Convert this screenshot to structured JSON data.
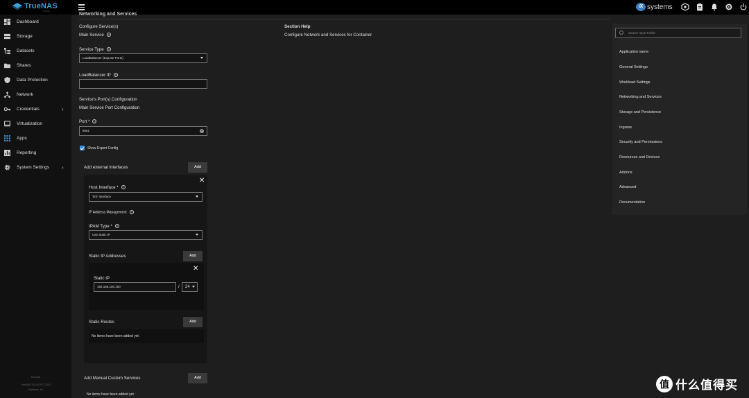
{
  "topbar": {
    "brand": "TrueNAS",
    "brand_sub": "SCALE",
    "ix_logo": "iX",
    "ix_word": "systems",
    "icons": [
      "hamburger-icon",
      "truecommand-icon",
      "clipboard-icon",
      "bell-icon",
      "settings-icon",
      "power-icon"
    ]
  },
  "sidebar": {
    "items": [
      {
        "label": "Dashboard",
        "icon": "dashboard-icon"
      },
      {
        "label": "Storage",
        "icon": "storage-icon"
      },
      {
        "label": "Datasets",
        "icon": "datasets-icon"
      },
      {
        "label": "Shares",
        "icon": "shares-icon"
      },
      {
        "label": "Data Protection",
        "icon": "shield-icon"
      },
      {
        "label": "Network",
        "icon": "network-icon"
      },
      {
        "label": "Credentials",
        "icon": "key-icon",
        "chevron": "›"
      },
      {
        "label": "Virtualization",
        "icon": "monitor-icon"
      },
      {
        "label": "Apps",
        "icon": "apps-grid-icon"
      },
      {
        "label": "Reporting",
        "icon": "chart-icon"
      },
      {
        "label": "System Settings",
        "icon": "gear-icon",
        "chevron": "›"
      }
    ],
    "footer": {
      "hostname": "truenas",
      "version": "TrueNAS SCALE ® © 2024",
      "company": "iXsystems, Inc."
    }
  },
  "form": {
    "section_title": "Networking and Services",
    "configure_services": "Configure Service(s)",
    "main_service": "Main Service",
    "service_type_label": "Service Type",
    "service_type_value": "LoadBalancer (Expose Ports)",
    "lb_ip_label": "LoadBalancer IP",
    "lb_ip_value": "",
    "ports_config": "Service's Port(s) Configuration",
    "main_port_config": "Main Service Port Configuration",
    "port_label": "Port *",
    "port_value": "8561",
    "expert_label": "Show Expert Config",
    "ext_interfaces_label": "Add external Interfaces",
    "add": "Add",
    "host_iface_label": "Host Interface *",
    "host_iface_value": "'br0' Interface",
    "ipam_heading": "IP Address Management",
    "ipam_type_label": "IPAM Type *",
    "ipam_type_value": "Use Static IP",
    "static_ips_label": "Static IP Addresses",
    "static_ip_label": "Static IP",
    "static_ip_value": "192.168.100.100",
    "slash": "/",
    "cidr_value": "24",
    "static_routes_label": "Static Routes",
    "no_items": "No items have been added yet.",
    "manual_services_label": "Add Manual Custom Services",
    "no_items_2": "No items have been added yet."
  },
  "help": {
    "title": "Section Help",
    "text": "Configure Network and Services for Container"
  },
  "right_panel": {
    "search_placeholder": "Search Input Fields",
    "links": [
      "Application name",
      "General Settings",
      "Workload Settings",
      "Networking and Services",
      "Storage and Persistence",
      "Ingress",
      "Security and Permissions",
      "Resources and Devices",
      "Addons",
      "Advanced",
      "Documentation"
    ]
  },
  "watermark": {
    "badge": "值",
    "text": "什么值得买"
  },
  "colors": {
    "accent": "#3b8fd8",
    "brand": "#3aa0d8",
    "sidebar_bg": "#111111",
    "main_bg": "#1e1e1e"
  }
}
